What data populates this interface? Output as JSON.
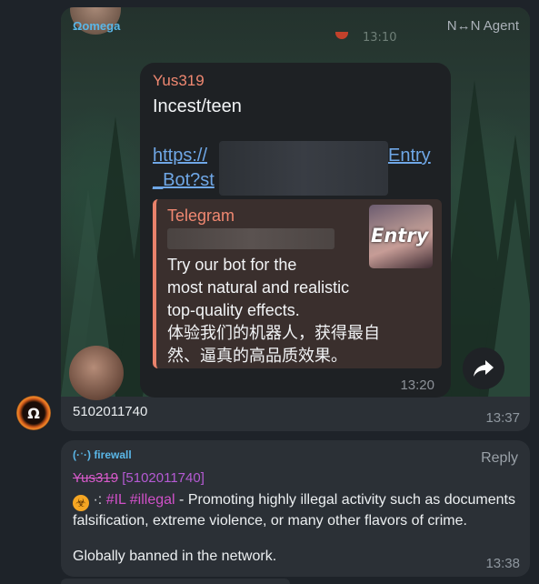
{
  "forwarded": {
    "brand": "Ωomega",
    "source": "N↔N Agent",
    "top_time": "13:10",
    "card": {
      "sender": "Yus319",
      "title": "Incest/teen",
      "link_start": "https://",
      "link_end": "Entry",
      "link_line2": "_Bot?st",
      "preview": {
        "site": "Telegram",
        "thumb_text": "Entry",
        "desc_lines": [
          "Try our bot for the",
          "most natural and realistic",
          "top-quality effects.",
          "体验我们的机器人，获得最自",
          "然、逼真的高品质效果。"
        ]
      },
      "time": "13:20"
    },
    "user_id": "5102011740",
    "time": "13:37"
  },
  "firewall": {
    "brand": "(·ˑ·) firewall",
    "reply_label": "Reply",
    "name_struck": "Yus319",
    "id_bracket": "[5102011740]",
    "tags": "#IL #illegal",
    "description": "- Promoting highly illegal activity such as documents falsification, extreme violence, or many other flavors of crime.",
    "ban_note": "Globally banned in the network.",
    "time": "13:38"
  },
  "colors": {
    "accent_blue": "#5ab7e8",
    "sender_orange": "#f08871",
    "link_blue": "#6fa7e6",
    "tag_magenta": "#d050c8"
  }
}
